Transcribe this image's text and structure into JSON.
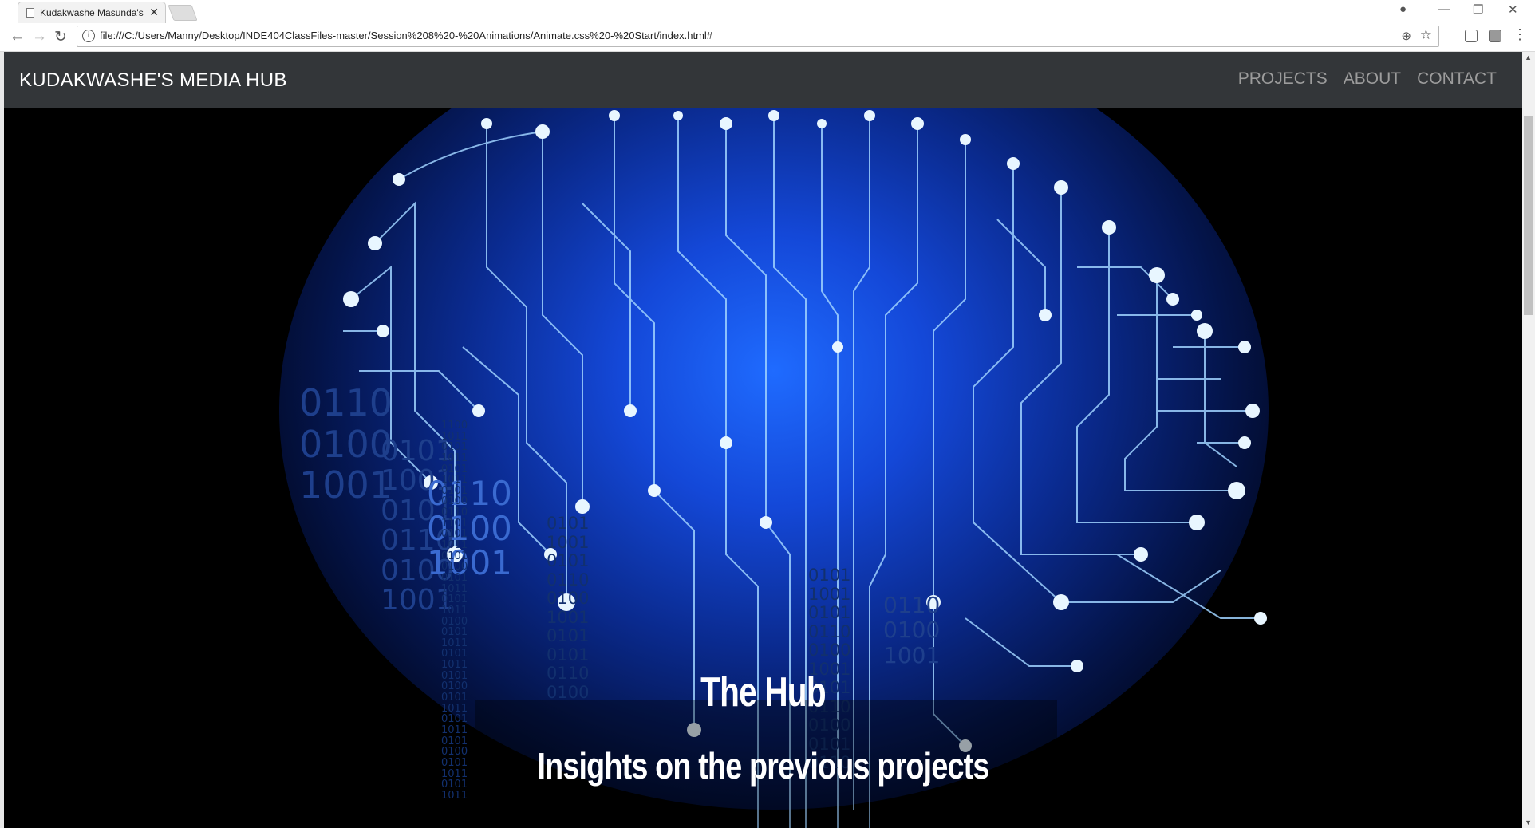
{
  "browser": {
    "tab_title": "Kudakwashe Masunda's",
    "tab_close": "✕",
    "url": "file:///C:/Users/Manny/Desktop/INDE404ClassFiles-master/Session%208%20-%20Animations/Animate.css%20-%20Start/index.html#",
    "icons": [
      "back-arrow-icon",
      "forward-arrow-icon",
      "reload-icon",
      "info-icon",
      "zoom-icon",
      "star-icon",
      "menu-icon"
    ]
  },
  "site": {
    "brand": "KUDAKWASHE'S MEDIA HUB",
    "nav": [
      {
        "label": "PROJECTS"
      },
      {
        "label": "ABOUT"
      },
      {
        "label": "CONTACT"
      }
    ]
  },
  "hero": {
    "title": "The Hub",
    "subtitle": "Insights on the previous projects",
    "binary_large": "0110\n0100\n1001",
    "binary_mid": "0101\n1001\n0101\n0110\n0100\n1001",
    "binary_center": "0110\n0100\n1001",
    "binary_right": "0110\n0100\n1001",
    "binary_col_a": "0101\n1001\n0101\n0110\n0100\n1001\n0101\n0101\n0110\n0100",
    "binary_col_b": "0101\n1001\n0101\n0110\n0100\n1001\n0101\n0110\n0100\n0101\n0110",
    "binary_small": "1100\n1011\n0101\n1011\n0101\n1011\n0101\n0100\n0110\n1101\n0101\n1011\n0101\n0100\n0101\n1011\n0101\n1011\n0100\n0101\n1011\n0101\n1011\n0101\n0100\n0101\n1011\n0101\n1011\n0101\n0100\n0101\n1011\n0101\n1011"
  },
  "colors": {
    "navbar": "#333639",
    "nav_link": "#9c9c9c",
    "glow": "#1f6bff"
  }
}
